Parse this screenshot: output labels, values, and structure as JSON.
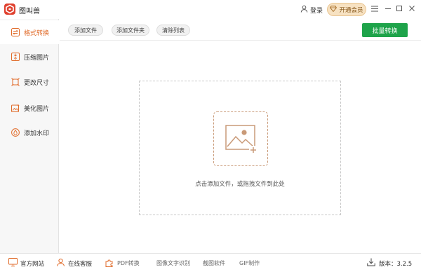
{
  "app": {
    "title": "图叫兽"
  },
  "header": {
    "login_label": "登录",
    "vip_label": "开通会员"
  },
  "sidebar": {
    "items": [
      {
        "label": "格式转换",
        "icon": "convert-icon"
      },
      {
        "label": "压缩图片",
        "icon": "compress-icon"
      },
      {
        "label": "更改尺寸",
        "icon": "resize-icon"
      },
      {
        "label": "美化图片",
        "icon": "beautify-icon"
      },
      {
        "label": "添加水印",
        "icon": "watermark-icon"
      }
    ],
    "active_index": 0
  },
  "toolbar": {
    "add_file": "添加文件",
    "add_folder": "添加文件夹",
    "clear_list": "清除列表",
    "batch_convert": "批量转换"
  },
  "dropzone": {
    "hint": "点击添加文件，或拖拽文件到此处"
  },
  "footer": {
    "official_site": "官方网站",
    "online_support": "在线客服",
    "pdf_convert": "PDF转换",
    "ocr": "图像文字识别",
    "screenshot_tool": "截图软件",
    "gif_maker": "GIF制作",
    "version_label": "版本：3.2.5"
  },
  "colors": {
    "accent": "#e06a28",
    "primary_green": "#1ea34a",
    "vip_bg": "#f7e2c2",
    "logo_red": "#e0412f"
  }
}
